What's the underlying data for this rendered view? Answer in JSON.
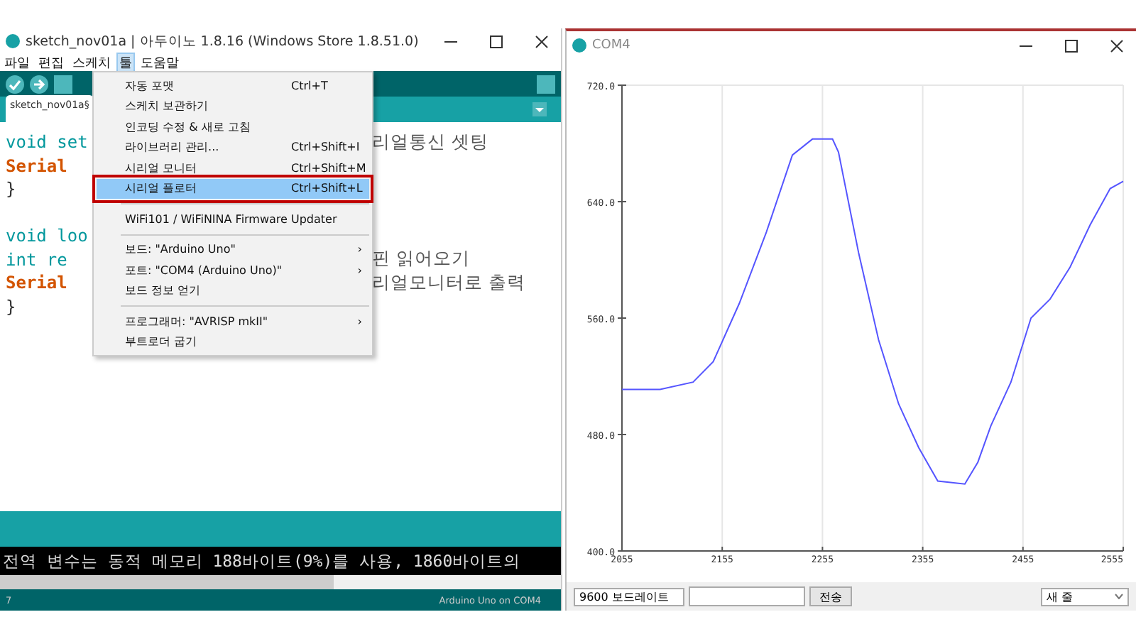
{
  "ide": {
    "title": "sketch_nov01a | 아두이노 1.8.16 (Windows Store 1.8.51.0)",
    "menu": [
      {
        "label": "파일",
        "selected": false
      },
      {
        "label": "편집",
        "selected": false
      },
      {
        "label": "스케치",
        "selected": false
      },
      {
        "label": "툴",
        "selected": true
      },
      {
        "label": "도움말",
        "selected": false
      }
    ],
    "tab": "sketch_nov01a§",
    "code": [
      {
        "code": "void set",
        "comment": "리얼통신 셋팅",
        "kind": "keyword"
      },
      {
        "code": "Serial",
        "kind": "call"
      },
      {
        "code": "}",
        "kind": "plain"
      },
      {
        "kind": "blank"
      },
      {
        "code": "void loo",
        "kind": "keyword"
      },
      {
        "code": "int re",
        "comment": "핀 읽어오기",
        "kind": "keyword"
      },
      {
        "code": "Serial",
        "comment": "리얼모니터로 출력",
        "kind": "call"
      },
      {
        "code": "}",
        "kind": "plain"
      }
    ],
    "console": "전역 변수는 동적 메모리 188바이트(9%)를 사용, 1860바이트의",
    "status_line": "7",
    "status_board": "Arduino Uno on COM4",
    "tools_menu": [
      {
        "kind": "item",
        "label": "자동 포맷",
        "shortcut": "Ctrl+T",
        "selected": false
      },
      {
        "kind": "item",
        "label": "스케치 보관하기",
        "selected": false
      },
      {
        "kind": "item",
        "label": "인코딩 수정 & 새로 고침",
        "selected": false
      },
      {
        "kind": "item",
        "label": "라이브러리 관리...",
        "shortcut": "Ctrl+Shift+I",
        "selected": false
      },
      {
        "kind": "item",
        "label": "시리얼 모니터",
        "shortcut": "Ctrl+Shift+M",
        "selected": false
      },
      {
        "kind": "item",
        "label": "시리얼 플로터",
        "shortcut": "Ctrl+Shift+L",
        "selected": true
      },
      {
        "kind": "separator"
      },
      {
        "kind": "item",
        "label": "WiFi101 / WiFiNINA Firmware Updater",
        "selected": false
      },
      {
        "kind": "separator"
      },
      {
        "kind": "submenu",
        "label": "보드: \"Arduino Uno\"",
        "arrow": "›",
        "selected": false
      },
      {
        "kind": "submenu",
        "label": "포트: \"COM4 (Arduino Uno)\"",
        "arrow": "›",
        "selected": false
      },
      {
        "kind": "item",
        "label": "보드 정보 얻기",
        "selected": false
      },
      {
        "kind": "separator"
      },
      {
        "kind": "submenu",
        "label": "프로그래머: \"AVRISP mkII\"",
        "arrow": "›",
        "selected": false
      },
      {
        "kind": "item",
        "label": "부트로더 굽기",
        "selected": false
      }
    ]
  },
  "plotter": {
    "title": "COM4",
    "chart_data": {
      "type": "line",
      "x": [
        2055,
        2093,
        2126,
        2146,
        2172,
        2199,
        2225,
        2245,
        2265,
        2271,
        2291,
        2311,
        2331,
        2351,
        2370,
        2397,
        2410,
        2423,
        2443,
        2463,
        2482,
        2502,
        2522,
        2542,
        2555
      ],
      "series": [
        {
          "color": "#5555ff",
          "values": [
            511,
            511,
            516,
            530,
            570,
            619,
            672,
            683,
            683,
            674,
            605,
            545,
            501,
            471,
            448,
            446,
            461,
            486,
            516,
            560,
            573,
            595,
            624,
            649,
            654
          ]
        }
      ],
      "grid": true,
      "xlim": [
        2055,
        2555
      ],
      "ylim": [
        400,
        720
      ],
      "xticks": [
        {
          "value": 2055,
          "label": "2055"
        },
        {
          "value": 2155,
          "label": "2155"
        },
        {
          "value": 2255,
          "label": "2255"
        },
        {
          "value": 2355,
          "label": "2355"
        },
        {
          "value": 2455,
          "label": "2455"
        },
        {
          "value": 2555,
          "label": "2555"
        }
      ],
      "yticks": [
        {
          "value": 400,
          "label": "400.0"
        },
        {
          "value": 480,
          "label": "480.0"
        },
        {
          "value": 560,
          "label": "560.0"
        },
        {
          "value": 640,
          "label": "640.0"
        },
        {
          "value": 720,
          "label": "720.0"
        }
      ]
    },
    "baud": "9600 보드레이트",
    "send": "전송",
    "line_ending": "새 줄"
  }
}
